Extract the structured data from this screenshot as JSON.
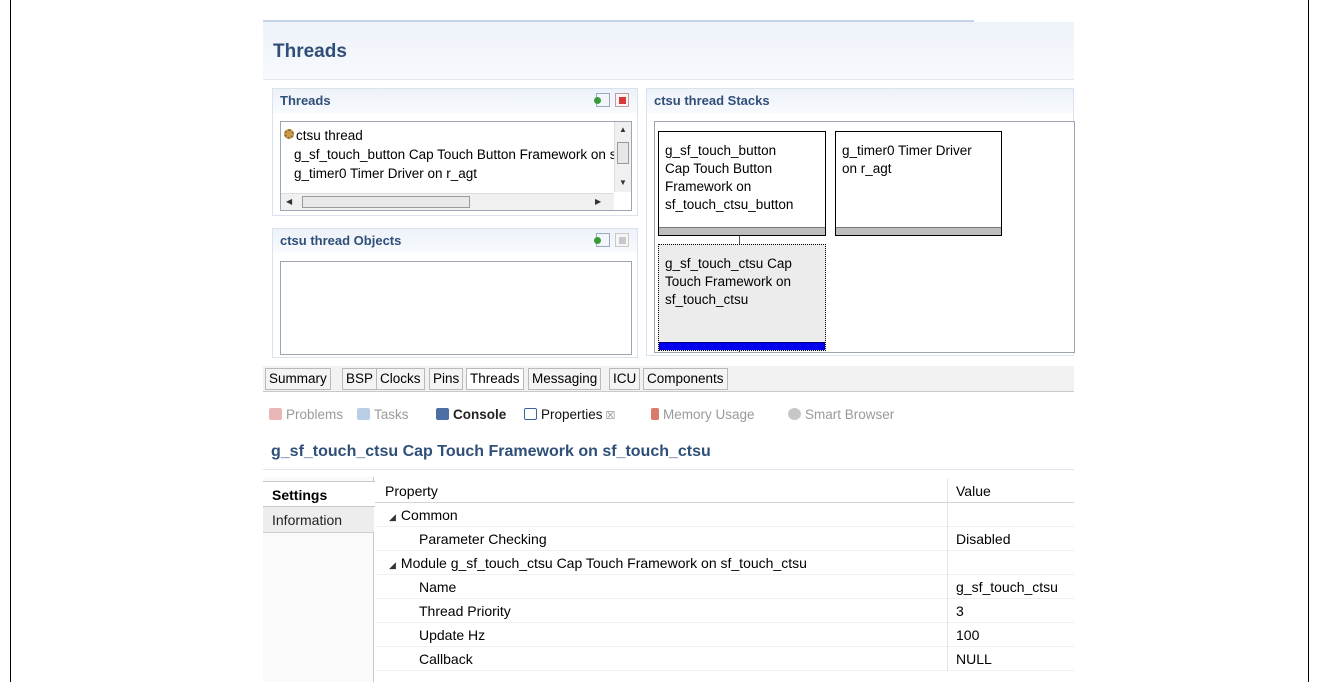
{
  "editor": {
    "title": "Threads"
  },
  "threads_panel": {
    "title": "Threads",
    "items": [
      {
        "label": "ctsu thread"
      },
      {
        "label": "g_sf_touch_button Cap Touch Button Framework on sf_touch_ctsu_button"
      },
      {
        "label": "g_timer0 Timer Driver on r_agt"
      }
    ]
  },
  "objects_panel": {
    "title": "ctsu thread Objects"
  },
  "stacks_panel": {
    "title": "ctsu thread Stacks",
    "cards": [
      {
        "lines": [
          "g_sf_touch_button",
          "Cap Touch Button",
          "Framework on",
          "sf_touch_ctsu_button"
        ]
      },
      {
        "lines": [
          "g_timer0 Timer Driver",
          "on r_agt"
        ]
      },
      {
        "lines": [
          "g_sf_touch_ctsu Cap",
          "Touch Framework on",
          "sf_touch_ctsu"
        ],
        "selected": true
      }
    ]
  },
  "editor_tabs": [
    "Summary",
    "BSP",
    "Clocks",
    "Pins",
    "Threads",
    "Messaging",
    "ICU",
    "Components"
  ],
  "active_editor_tab": "Threads",
  "view_tabs": {
    "problems": "Problems",
    "tasks": "Tasks",
    "console": "Console",
    "properties": "Properties",
    "properties_close": "☒",
    "memory": "Memory Usage",
    "smart_browser": "Smart Browser"
  },
  "properties": {
    "title": "g_sf_touch_ctsu Cap Touch Framework on sf_touch_ctsu",
    "side_tabs": {
      "settings": "Settings",
      "information": "Information"
    },
    "columns": {
      "property": "Property",
      "value": "Value"
    },
    "rows": [
      {
        "property": "Common",
        "value": "",
        "group": true
      },
      {
        "property": "Parameter Checking",
        "value": "Disabled"
      },
      {
        "property": "Module g_sf_touch_ctsu Cap Touch Framework on sf_touch_ctsu",
        "value": "",
        "group": true
      },
      {
        "property": "Name",
        "value": "g_sf_touch_ctsu"
      },
      {
        "property": "Thread Priority",
        "value": "3"
      },
      {
        "property": "Update Hz",
        "value": "100"
      },
      {
        "property": "Callback",
        "value": "NULL"
      }
    ]
  },
  "colors": {
    "title_blue": "#2f4f79",
    "selection_bar": "#0000ee"
  }
}
